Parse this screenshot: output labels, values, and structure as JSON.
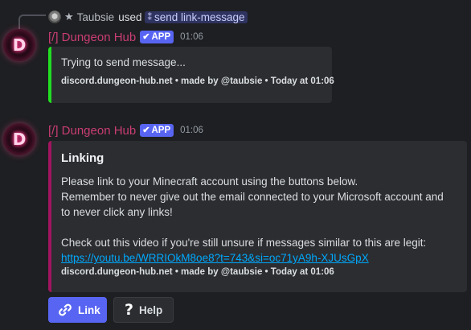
{
  "reply": {
    "username": "Taubsie",
    "used_text": "used",
    "command": "send link-message"
  },
  "messages": [
    {
      "author": "[/] Dungeon Hub",
      "avatar_letter": "D",
      "app_tag": "APP",
      "time": "01:06",
      "embed": {
        "accent_color": "#22dd22",
        "description": "Trying to send message...",
        "footer": "discord.dungeon-hub.net • made by @taubsie • Today at 01:06"
      }
    },
    {
      "author": "[/] Dungeon Hub",
      "avatar_letter": "D",
      "app_tag": "APP",
      "time": "01:06",
      "embed": {
        "accent_color": "#a0155f",
        "title": "Linking",
        "description_lines": [
          "Please link to your Minecraft account using the buttons below.",
          "Remember to never give out the email connected to your Microsoft account and",
          "to never click any links!",
          "Check out this video if you're still unsure if messages similar to this are legit:"
        ],
        "link": "https://youtu.be/WRRIOkM8oe8?t=743&si=oc71yA9h-XJUsGpX",
        "footer": "discord.dungeon-hub.net • made by @taubsie • Today at 01:06"
      },
      "buttons": [
        {
          "label": "Link",
          "icon": "link-icon",
          "style": "primary"
        },
        {
          "label": "Help",
          "icon": "question-icon",
          "style": "secondary"
        }
      ]
    }
  ]
}
